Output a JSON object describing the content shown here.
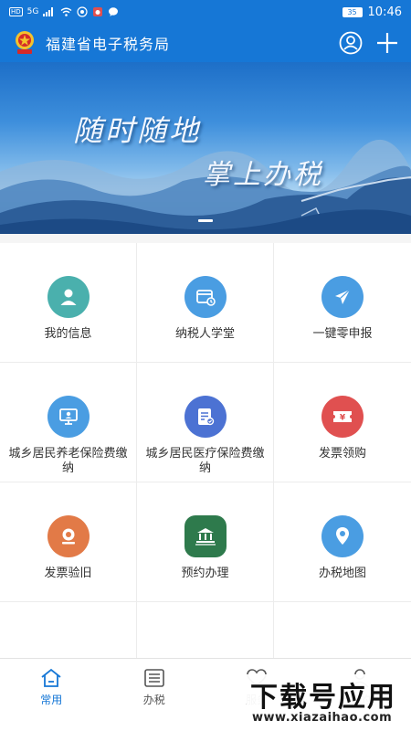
{
  "status_bar": {
    "left_badges": [
      "HD",
      "5G"
    ],
    "time": "10:46",
    "battery": "35"
  },
  "header": {
    "title": "福建省电子税务局",
    "icons": [
      "emblem-icon",
      "user-icon",
      "plus-icon"
    ]
  },
  "banner": {
    "line1": "随时随地",
    "line2": "掌上办税"
  },
  "grid": [
    {
      "label": "我的信息",
      "icon": "user-icon",
      "color": "#4ab0ad"
    },
    {
      "label": "纳税人学堂",
      "icon": "calendar-icon",
      "color": "#4a9de2"
    },
    {
      "label": "一键零申报",
      "icon": "send-icon",
      "color": "#4a9de2"
    },
    {
      "label": "城乡居民养老保险费缴纳",
      "icon": "monitor-icon",
      "color": "#4a9de2"
    },
    {
      "label": "城乡居民医疗保险费缴纳",
      "icon": "document-icon",
      "color": "#4c72d3"
    },
    {
      "label": "发票领购",
      "icon": "ticket-icon",
      "color": "#e05050"
    },
    {
      "label": "发票验旧",
      "icon": "stamp-icon",
      "color": "#e27a47"
    },
    {
      "label": "预约办理",
      "icon": "building-icon",
      "color": "#2e7a4c"
    },
    {
      "label": "办税地图",
      "icon": "map-pin-icon",
      "color": "#4a9de2"
    }
  ],
  "bottom_nav": [
    {
      "label": "常用",
      "icon": "home-icon",
      "active": true
    },
    {
      "label": "办税",
      "icon": "list-icon",
      "active": false
    },
    {
      "label": "服务",
      "icon": "heart-icon",
      "active": false
    },
    {
      "label": "我的",
      "icon": "person-icon",
      "active": false
    }
  ],
  "watermark": {
    "main": "下载号应用",
    "url": "www.xiazaihao.com"
  },
  "colors": {
    "brand": "#1677d6",
    "text": "#333333"
  }
}
